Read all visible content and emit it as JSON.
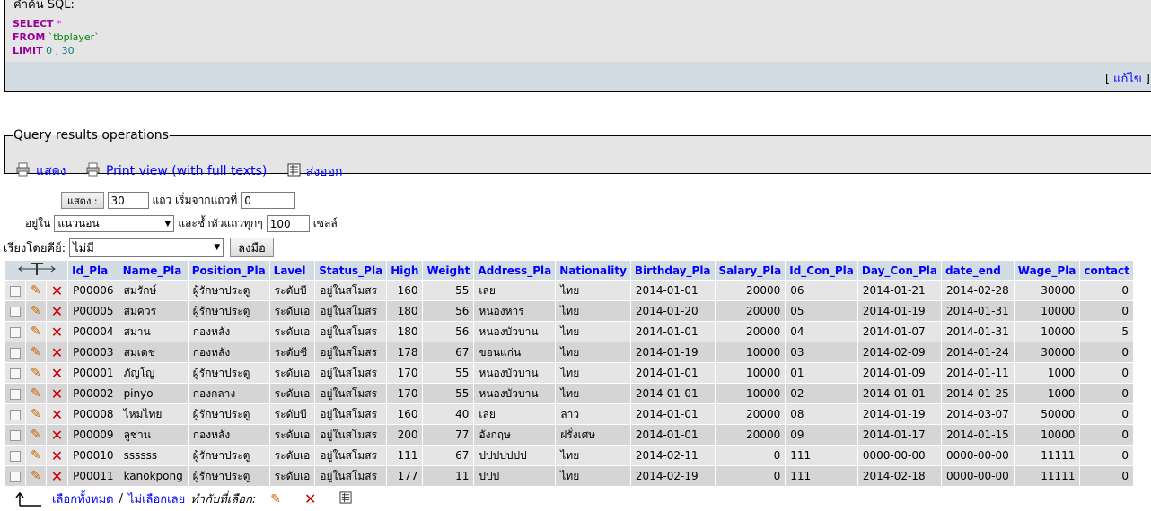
{
  "sql": {
    "title": "คำค้น SQL:",
    "select_kw": "SELECT",
    "star": "*",
    "from_kw": "FROM",
    "table": "`tbplayer`",
    "limit_kw": "LIMIT",
    "limit_val": "0 , 30",
    "edit_open": "[",
    "edit_label": "แก้ไข",
    "edit_close": "]"
  },
  "qro": {
    "legend": "Query results operations",
    "show_label": "แสดง",
    "print_label": "Print view (with full texts)",
    "export_label": "ส่งออก"
  },
  "nav": {
    "show_btn": "แสดง :",
    "rows_value": "30",
    "rows_start_label": "แถว เริ่มจากแถวที่",
    "start_value": "0",
    "in_label": "อยู่ใน",
    "mode_value": "แนวนอน",
    "repeat_label": "และซ้ำหัวแถวทุกๆ",
    "repeat_value": "100",
    "cells_label": "เซลล์",
    "sort_label": "เรียงโดยคีย์:",
    "sort_value": "ไม่มี",
    "go_btn": "ลงมือ"
  },
  "table": {
    "columns": [
      "Id_Pla",
      "Name_Pla",
      "Position_Pla",
      "Lavel",
      "Status_Pla",
      "High",
      "Weight",
      "Address_Pla",
      "Nationality",
      "Birthday_Pla",
      "Salary_Pla",
      "Id_Con_Pla",
      "Day_Con_Pla",
      "date_end",
      "Wage_Pla",
      "contact"
    ],
    "rows": [
      [
        "P00006",
        "สมรักษ์",
        "ผู้รักษาประตู",
        "ระดับบี",
        "อยู่ในสโมสร",
        "160",
        "55",
        "เลย",
        "ไทย",
        "2014-01-01",
        "20000",
        "06",
        "2014-01-21",
        "2014-02-28",
        "30000",
        "0"
      ],
      [
        "P00005",
        "สมควร",
        "ผู้รักษาประตู",
        "ระดับเอ",
        "อยู่ในสโมสร",
        "180",
        "56",
        "หนองหาร",
        "ไทย",
        "2014-01-20",
        "20000",
        "05",
        "2014-01-19",
        "2014-01-31",
        "10000",
        "0"
      ],
      [
        "P00004",
        "สมาน",
        "กองหลัง",
        "ระดับเอ",
        "อยู่ในสโมสร",
        "180",
        "56",
        "หนองบัวบาน",
        "ไทย",
        "2014-01-01",
        "20000",
        "04",
        "2014-01-07",
        "2014-01-31",
        "10000",
        "5"
      ],
      [
        "P00003",
        "สมเดช",
        "กองหลัง",
        "ระดับซี",
        "อยู่ในสโมสร",
        "178",
        "67",
        "ขอนแก่น",
        "ไทย",
        "2014-01-19",
        "10000",
        "03",
        "2014-02-09",
        "2014-01-24",
        "30000",
        "0"
      ],
      [
        "P00001",
        "ภัญโญ",
        "ผู้รักษาประตู",
        "ระดับเอ",
        "อยู่ในสโมสร",
        "170",
        "55",
        "หนองบัวบาน",
        "ไทย",
        "2014-01-01",
        "10000",
        "01",
        "2014-01-09",
        "2014-01-11",
        "1000",
        "0"
      ],
      [
        "P00002",
        "pinyo",
        "กองกลาง",
        "ระดับเอ",
        "อยู่ในสโมสร",
        "170",
        "55",
        "หนองบัวบาน",
        "ไทย",
        "2014-01-01",
        "10000",
        "02",
        "2014-01-01",
        "2014-01-25",
        "1000",
        "0"
      ],
      [
        "P00008",
        "ไหมไทย",
        "ผู้รักษาประตู",
        "ระดับบี",
        "อยู่ในสโมสร",
        "160",
        "40",
        "เลย",
        "ลาว",
        "2014-01-01",
        "20000",
        "08",
        "2014-01-19",
        "2014-03-07",
        "50000",
        "0"
      ],
      [
        "P00009",
        "ลูชาน",
        "กองหลัง",
        "ระดับเอ",
        "อยู่ในสโมสร",
        "200",
        "77",
        "อังกฤษ",
        "ฝรั่งเศษ",
        "2014-01-01",
        "20000",
        "09",
        "2014-01-17",
        "2014-01-15",
        "10000",
        "0"
      ],
      [
        "P00010",
        "ssssss",
        "ผู้รักษาประตู",
        "ระดับเอ",
        "อยู่ในสโมสร",
        "111",
        "67",
        "ปปปปปปป",
        "ไทย",
        "2014-02-11",
        "0",
        "111",
        "0000-00-00",
        "0000-00-00",
        "11111",
        "0"
      ],
      [
        "P00011",
        "kanokpong",
        "ผู้รักษาประตู",
        "ระดับเอ",
        "อยู่ในสโมสร",
        "177",
        "11",
        "ปปป",
        "ไทย",
        "2014-02-19",
        "0",
        "111",
        "2014-02-18",
        "0000-00-00",
        "11111",
        "0"
      ]
    ]
  },
  "bottom": {
    "check_all": "เลือกทั้งหมด",
    "sep": "/",
    "uncheck_all": "ไม่เลือกเลย",
    "with_selected": "ทำกับที่เลือก:"
  },
  "icons": {
    "edit": "pencil-icon",
    "delete": "delete-cross-icon",
    "export": "export-icon",
    "print": "print-icon"
  }
}
